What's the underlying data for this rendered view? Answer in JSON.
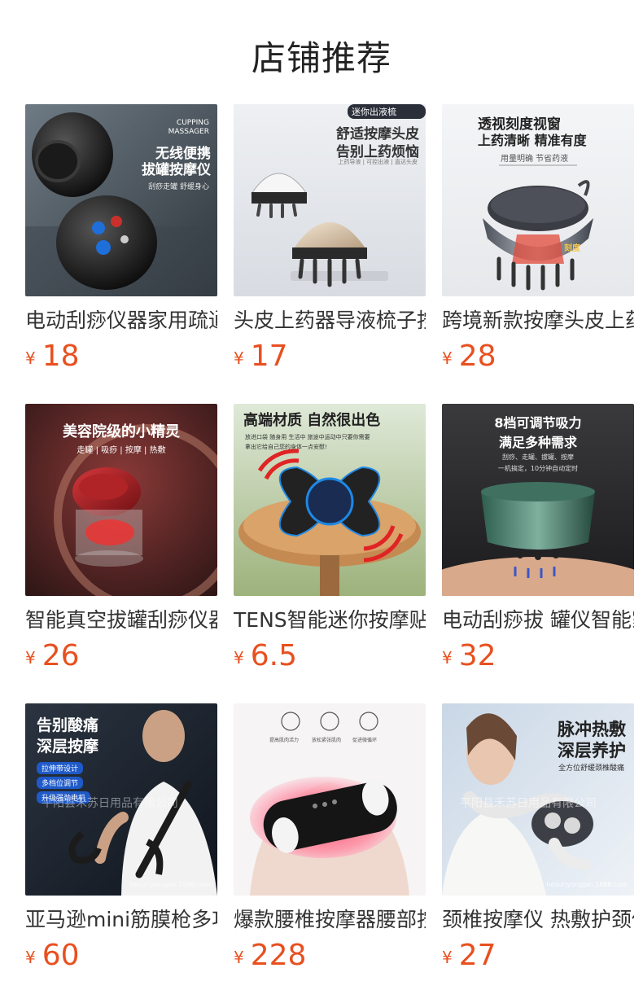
{
  "section_title": "店铺推荐",
  "currency_symbol": "¥",
  "products": [
    {
      "name": "电动刮痧仪器家用疏通经络",
      "price": "18",
      "image_text": {
        "en": "CUPPING MASSAGER",
        "h1": "无线便携",
        "h2": "拔罐按摩仪",
        "sub": "刮痧走罐 舒缓身心"
      }
    },
    {
      "name": "头皮上药器导液梳子按摩",
      "price": "17",
      "image_text": {
        "badge": "迷你出液梳",
        "h1": "舒适按摩头皮",
        "h2": "告别上药烦恼",
        "sub": "上药导液 | 可控出液 | 直达头皮"
      }
    },
    {
      "name": "跨境新款按摩头皮上药器",
      "price": "28",
      "image_text": {
        "h1": "透视刻度视窗",
        "h2": "上药清晰 精准有度",
        "sub": "用量明确 节省药液",
        "mark": "刻度"
      }
    },
    {
      "name": "智能真空拔罐刮痧仪器家用",
      "price": "26",
      "image_text": {
        "h1": "美容院级的小精灵",
        "sub": "走罐 | 吸痧 | 按摩 | 热敷"
      }
    },
    {
      "name": "TENS智能迷你按摩贴颈椎",
      "price": "6.5",
      "image_text": {
        "h1": "高端材质 自然很出色",
        "sub1": "放进口袋 随身用 生活中 旅途中运动中只要你需要",
        "sub2": "拿出它给自己您的身体一点安慰!"
      }
    },
    {
      "name": "电动刮痧拔 罐仪智能家用",
      "price": "32",
      "image_text": {
        "h1": "8档可调节吸力",
        "h2": "满足多种需求",
        "sub1": "刮痧、走罐、拔罐、按摩",
        "sub2": "一机搞定，10分钟自动定时"
      }
    },
    {
      "name": "亚马逊mini筋膜枪多功能",
      "price": "60",
      "image_text": {
        "h1": "告别酸痛",
        "h2": "深层按摩",
        "tags": [
          "拉伸带设计",
          "多档位调节",
          "升级强劲电机"
        ],
        "watermark": "平阳县禾苏日用品有限公司",
        "url": "hesuriyongpin.1688.com"
      }
    },
    {
      "name": "爆款腰椎按摩器腰部按摩",
      "price": "228",
      "image_text": {
        "icons": [
          "提高肌肉活力",
          "放松紧张肌肉",
          "促进微循环"
        ]
      }
    },
    {
      "name": "颈椎按摩仪 热敷护颈仪",
      "price": "27",
      "image_text": {
        "h1": "脉冲热敷",
        "h2": "深层养护",
        "sub": "全方位舒缓颈椎酸痛",
        "watermark": "平阳县禾苏日用品有限公司",
        "url": "hesuriyongpin.1688.com"
      }
    }
  ]
}
